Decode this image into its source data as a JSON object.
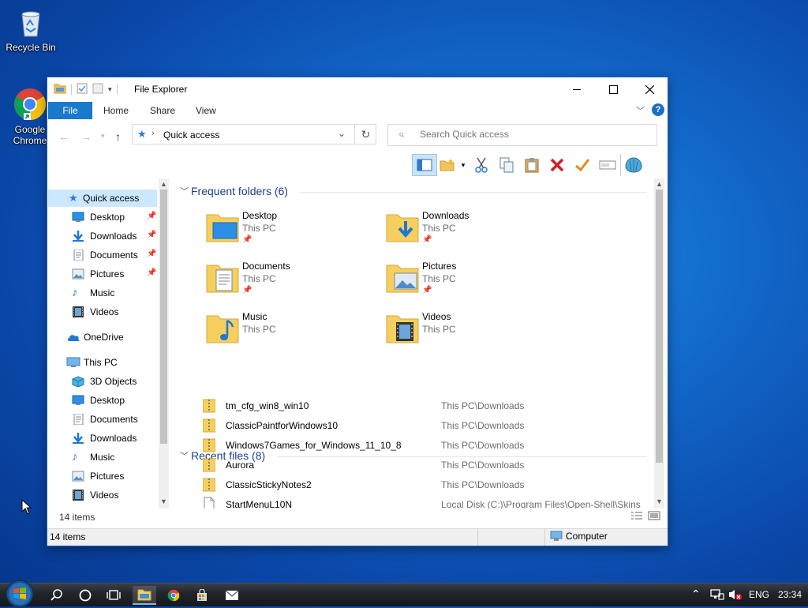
{
  "desktop": {
    "icons": [
      {
        "label": "Recycle Bin",
        "icon": "recycle-bin-icon"
      },
      {
        "label": "Google Chrome",
        "icon": "chrome-icon"
      }
    ]
  },
  "window": {
    "title": "File Explorer",
    "ribbon": {
      "file": "File",
      "home": "Home",
      "share": "Share",
      "view": "View",
      "help": "?"
    },
    "address": {
      "location": "Quick access"
    },
    "search": {
      "placeholder": "Search Quick access"
    },
    "nav": {
      "quick_access": "Quick access",
      "pinned": [
        {
          "label": "Desktop",
          "icon": "desktop-icon",
          "pinned": true
        },
        {
          "label": "Downloads",
          "icon": "downloads-icon",
          "pinned": true
        },
        {
          "label": "Documents",
          "icon": "documents-icon",
          "pinned": true
        },
        {
          "label": "Pictures",
          "icon": "pictures-icon",
          "pinned": true
        },
        {
          "label": "Music",
          "icon": "music-icon",
          "pinned": false
        },
        {
          "label": "Videos",
          "icon": "videos-icon",
          "pinned": false
        }
      ],
      "onedrive": "OneDrive",
      "this_pc": "This PC",
      "this_pc_items": [
        {
          "label": "3D Objects",
          "icon": "3d-objects-icon"
        },
        {
          "label": "Desktop",
          "icon": "desktop-icon"
        },
        {
          "label": "Documents",
          "icon": "documents-icon"
        },
        {
          "label": "Downloads",
          "icon": "downloads-icon"
        },
        {
          "label": "Music",
          "icon": "music-icon"
        },
        {
          "label": "Pictures",
          "icon": "pictures-icon"
        },
        {
          "label": "Videos",
          "icon": "videos-icon"
        }
      ]
    },
    "frequent": {
      "heading": "Frequent folders (6)",
      "folders": [
        {
          "name": "Desktop",
          "location": "This PC",
          "icon": "desktop-folder-icon",
          "pinned": true
        },
        {
          "name": "Downloads",
          "location": "This PC",
          "icon": "downloads-folder-icon",
          "pinned": true
        },
        {
          "name": "Documents",
          "location": "This PC",
          "icon": "documents-folder-icon",
          "pinned": true
        },
        {
          "name": "Pictures",
          "location": "This PC",
          "icon": "pictures-folder-icon",
          "pinned": true
        },
        {
          "name": "Music",
          "location": "This PC",
          "icon": "music-folder-icon",
          "pinned": false
        },
        {
          "name": "Videos",
          "location": "This PC",
          "icon": "videos-folder-icon",
          "pinned": false
        }
      ]
    },
    "recent": {
      "heading": "Recent files (8)",
      "files": [
        {
          "name": "tm_cfg_win8_win10",
          "path": "This PC\\Downloads",
          "icon": "zip-folder-icon"
        },
        {
          "name": "ClassicPaintforWindows10",
          "path": "This PC\\Downloads",
          "icon": "zip-folder-icon"
        },
        {
          "name": "Windows7Games_for_Windows_11_10_8",
          "path": "This PC\\Downloads",
          "icon": "zip-folder-icon"
        },
        {
          "name": "Aurora",
          "path": "This PC\\Downloads",
          "icon": "zip-folder-icon"
        },
        {
          "name": "ClassicStickyNotes2",
          "path": "This PC\\Downloads",
          "icon": "zip-folder-icon"
        },
        {
          "name": "StartMenuL10N",
          "path": "Local Disk (C:)\\Program Files\\Open-Shell\\Skins",
          "icon": "file-icon"
        }
      ]
    },
    "item_count_inner": "14 items",
    "status": {
      "items": "14 items",
      "computer": "Computer"
    }
  },
  "taskbar": {
    "tray": {
      "lang": "ENG",
      "time": "23:34"
    }
  },
  "colors": {
    "accent": "#1979ca",
    "selection": "#cce8ff",
    "group_heading": "#1e3d8f"
  }
}
